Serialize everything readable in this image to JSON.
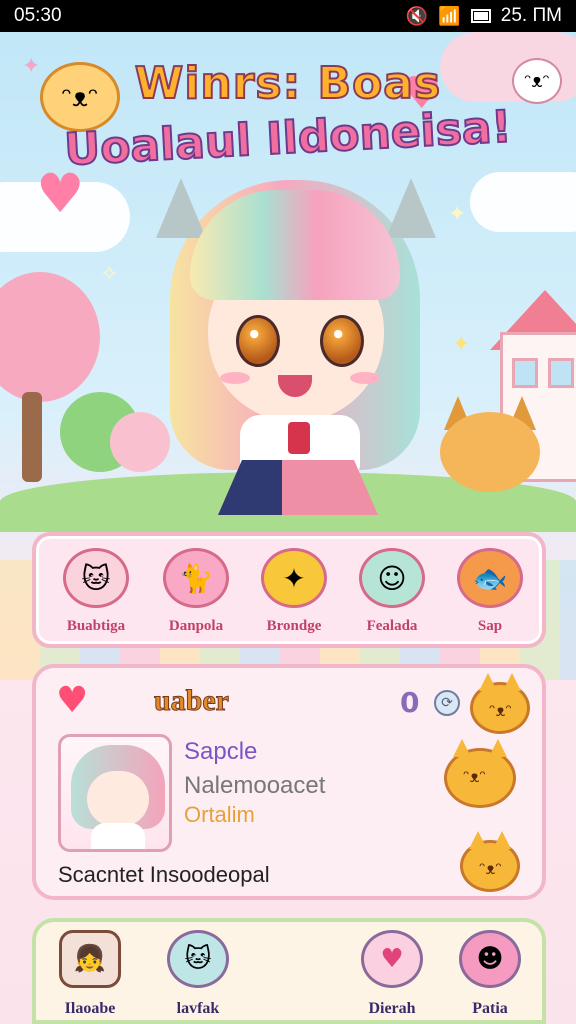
{
  "status_bar": {
    "time": "05:30",
    "right_text": "25. ΠM",
    "icons": [
      "mute-icon",
      "wifi-icon",
      "signal-icon",
      "battery-icon"
    ]
  },
  "title": {
    "line1": "Winrs: Boas",
    "line2": "Uoalaul Ildoneisa!"
  },
  "menu": {
    "items": [
      {
        "label": "Buabtiga",
        "icon": "cat-face-icon",
        "color": "#fbd3dd",
        "glyph": "🐱"
      },
      {
        "label": "Danpola",
        "icon": "pink-cat-icon",
        "color": "#f9a9c6",
        "glyph": "🐈"
      },
      {
        "label": "Brondge",
        "icon": "star-bubble-icon",
        "color": "#f8c73a",
        "glyph": "✦"
      },
      {
        "label": "Fealada",
        "icon": "sprout-girl-icon",
        "color": "#b6e4d6",
        "glyph": "☺"
      },
      {
        "label": "Sap",
        "icon": "fish-icon",
        "color": "#f59a4a",
        "glyph": "🐟"
      }
    ]
  },
  "profile": {
    "title": "uaber",
    "count": "0",
    "count_icon_glyph": "⟳",
    "name": "Sapcle",
    "subtitle": "Nalemooacet",
    "role": "Ortalim",
    "footer": "Scacntet Insoodeopal",
    "heart_glyph": "♥",
    "cat_glyph": "ᵔᴥᵔ"
  },
  "bottom_nav": {
    "items": [
      {
        "label": "Ilaoabe",
        "icon": "avatar-girl-icon",
        "color": "#f3e0d6",
        "glyph": "👧"
      },
      {
        "label": "lavfak",
        "icon": "cat-sprout-icon",
        "color": "#bfe6e6",
        "glyph": "🐱"
      },
      {
        "label": "Dierah",
        "icon": "heart-bubble-icon",
        "color": "#fbd0e0",
        "glyph": "♥"
      },
      {
        "label": "Patia",
        "icon": "pink-monster-icon",
        "color": "#f59ac0",
        "glyph": "☻"
      }
    ]
  }
}
